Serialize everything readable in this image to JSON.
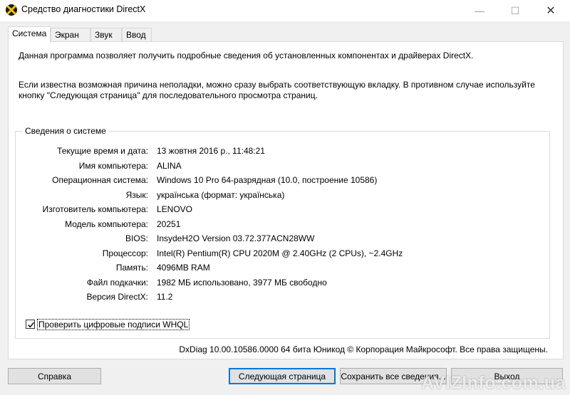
{
  "window": {
    "title": "Средство диагностики DirectX",
    "controls": {
      "minimize": "—",
      "maximize": "☐",
      "close": "✕"
    }
  },
  "tabs": [
    {
      "label": "Система",
      "active": true
    },
    {
      "label": "Экран",
      "active": false
    },
    {
      "label": "Звук",
      "active": false
    },
    {
      "label": "Ввод",
      "active": false
    }
  ],
  "intro": {
    "line1": "Данная программа позволяет получить подробные сведения об установленных компонентах и драйверах DirectX.",
    "line2": "Если известна возможная причина неполадки, можно сразу выбрать соответствующую вкладку. В противном случае используйте кнопку \"Следующая страница\" для последовательного просмотра страниц."
  },
  "system_info": {
    "group_title": "Сведения о системе",
    "rows": [
      {
        "label": "Текущие время и дата:",
        "value": "13 жовтня 2016 р., 11:48:21"
      },
      {
        "label": "Имя компьютера:",
        "value": "ALINA"
      },
      {
        "label": "Операционная система:",
        "value": "Windows 10 Pro 64-разрядная (10.0, построение 10586)"
      },
      {
        "label": "Язык:",
        "value": "українська (формат: українська)"
      },
      {
        "label": "Изготовитель компьютера:",
        "value": "LENOVO"
      },
      {
        "label": "Модель компьютера:",
        "value": "20251"
      },
      {
        "label": "BIOS:",
        "value": "InsydeH2O Version 03.72.377ACN28WW"
      },
      {
        "label": "Процессор:",
        "value": "Intel(R) Pentium(R) CPU 2020M @ 2.40GHz (2 CPUs), ~2.4GHz"
      },
      {
        "label": "Память:",
        "value": "4096MB RAM"
      },
      {
        "label": "Файл подкачки:",
        "value": "1982 МБ использовано, 3977 МБ свободно"
      },
      {
        "label": "Версия DirectX:",
        "value": "11.2"
      }
    ]
  },
  "whql_checkbox": {
    "label": "Проверить цифровые подписи WHQL",
    "checked": true
  },
  "copyright": "DxDiag 10.00.10586.0000 64 бита Юникод © Корпорация Майкрософт. Все права защищены.",
  "buttons": {
    "help": "Справка",
    "next": "Следующая страница",
    "save": "Сохранить все сведения...",
    "exit": "Выход"
  },
  "watermark": "AVIZInfo.com.ua"
}
